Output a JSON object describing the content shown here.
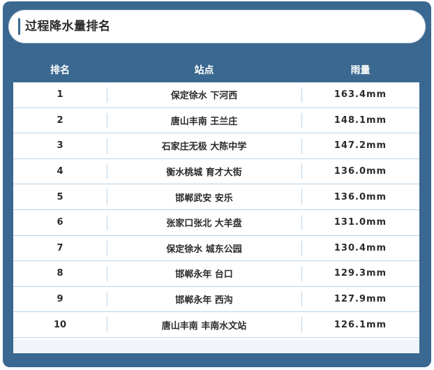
{
  "title": "过程降水量排名",
  "columns": {
    "rank": "排名",
    "station": "站点",
    "rainfall": "雨量"
  },
  "rows": [
    {
      "rank": "1",
      "station": "保定徐水 下河西",
      "rainfall": "163.4mm"
    },
    {
      "rank": "2",
      "station": "唐山丰南 王兰庄",
      "rainfall": "148.1mm"
    },
    {
      "rank": "3",
      "station": "石家庄无极 大陈中学",
      "rainfall": "147.2mm"
    },
    {
      "rank": "4",
      "station": "衡水桃城 育才大街",
      "rainfall": "136.0mm"
    },
    {
      "rank": "5",
      "station": "邯郸武安 安乐",
      "rainfall": "136.0mm"
    },
    {
      "rank": "6",
      "station": "张家口张北 大羊盘",
      "rainfall": "131.0mm"
    },
    {
      "rank": "7",
      "station": "保定徐水 城东公园",
      "rainfall": "130.4mm"
    },
    {
      "rank": "8",
      "station": "邯郸永年 台口",
      "rainfall": "129.3mm"
    },
    {
      "rank": "9",
      "station": "邯郸永年 西沟",
      "rainfall": "127.9mm"
    },
    {
      "rank": "10",
      "station": "唐山丰南 丰南水文站",
      "rainfall": "126.1mm"
    }
  ],
  "colors": {
    "panel": "#3a6890",
    "row_border": "#b9d3e8",
    "text": "#2b2b2b"
  }
}
